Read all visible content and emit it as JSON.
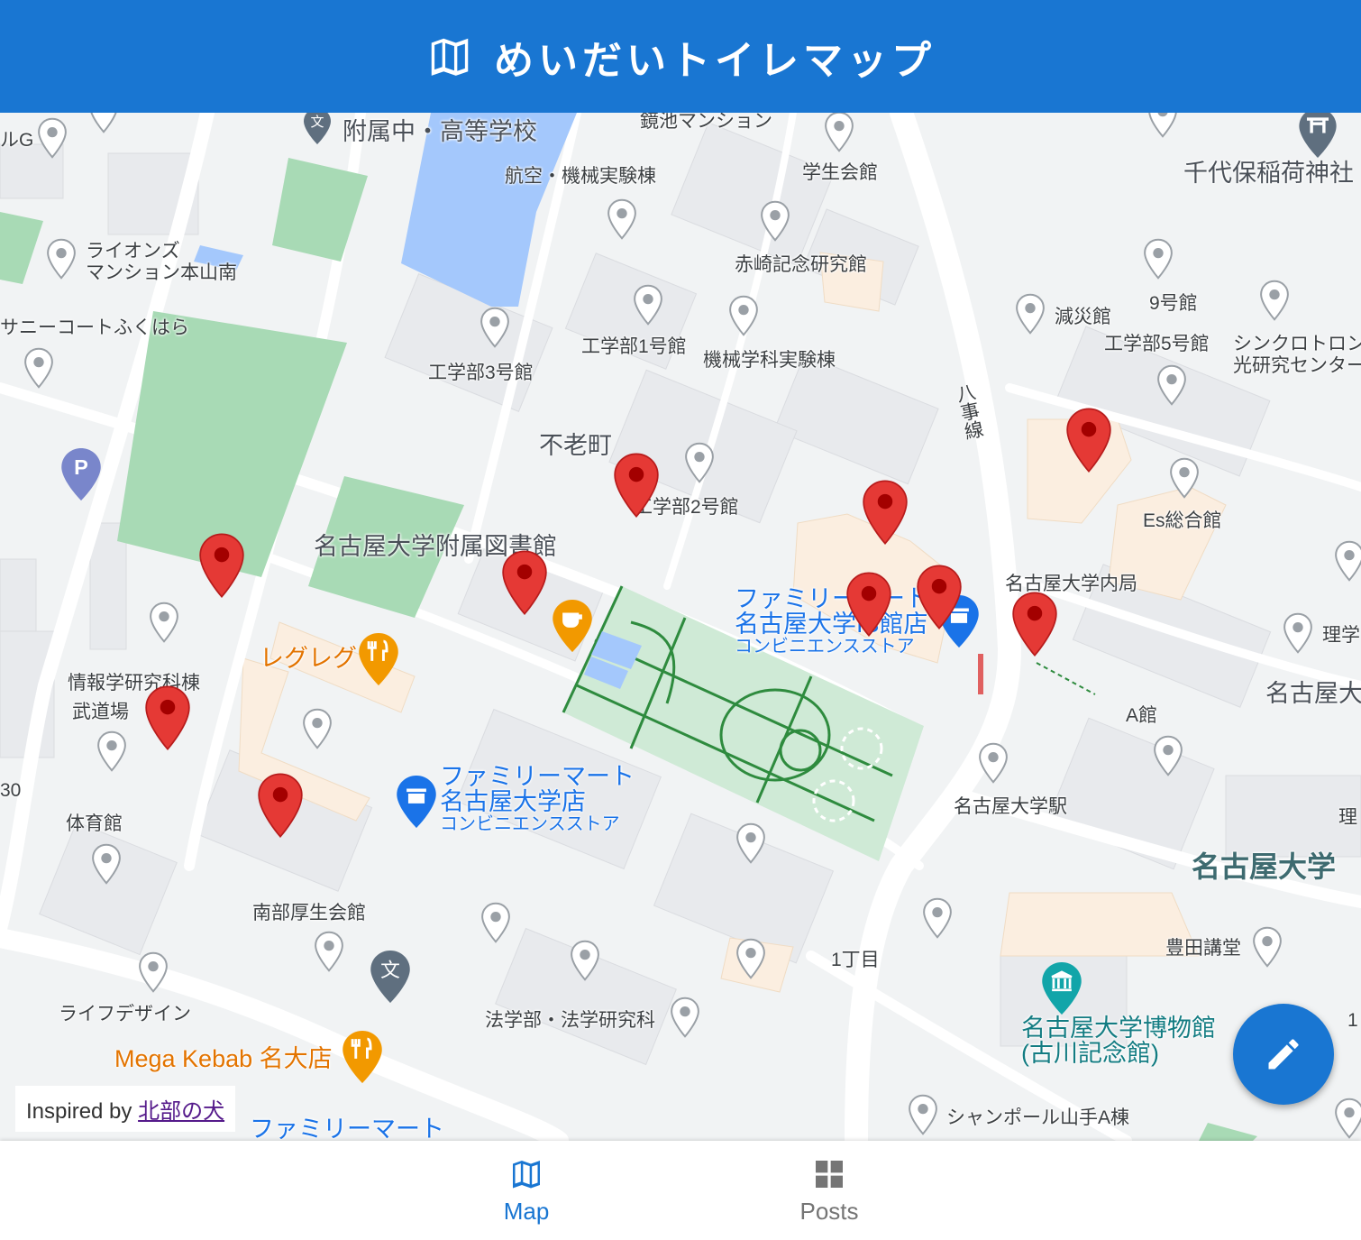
{
  "app": {
    "title": "めいだいトイレマップ"
  },
  "map": {
    "labels": {
      "fuzoku": "附属中・高等学校",
      "kagami": "鏡池マンション",
      "gakusei": "学生会館",
      "chiyoho": "千代保稲荷神社",
      "lG": "ルG",
      "koku": "航空・機械実験棟",
      "lions": "ライオンズ\nマンション本山南",
      "akasaki": "赤崎記念研究館",
      "kyu": "9号館",
      "gensai": "減災館",
      "sunny": "サニーコートふくはら",
      "kou1": "工学部1号館",
      "kikai": "機械学科実験棟",
      "kou5": "工学部5号館",
      "synch": "シンクロトロン\n光研究センター",
      "kou3": "工学部3号館",
      "hachiji": "八事線",
      "furou": "不老町",
      "kou2": "工学部2号館",
      "es": "Es総合館",
      "library": "名古屋大学附属図書館",
      "uchikyoku": "名古屋大学内局",
      "rigaku": "理学",
      "reguregu": "レグレグ",
      "joho": "情報学研究科棟",
      "budo": "武道場",
      "abuilding": "A館",
      "nagoya_daigaku_cut": "名古屋大",
      "num30": "30",
      "station": "名古屋大学駅",
      "rika2": "理",
      "taiiku": "体育館",
      "univ": "名古屋大学",
      "nanbu": "南部厚生会館",
      "toyoda": "豊田講堂",
      "chome": "1丁目",
      "lifedesign": "ライフデザイン",
      "hougaku": "法学部・法学研究科",
      "museum": "名古屋大学博物館\n(古川記念館)",
      "megakebab": "Mega Kebab 名大店",
      "shanpoel": "シャンポール山手A棟",
      "one": "1"
    },
    "fm1": {
      "name": "ファミリーマート\n名古屋大学店",
      "type": "コンビニエンスストア"
    },
    "fm2": {
      "name": "ファミリーマート\n名古屋大学IB館店",
      "type": "コンビニエンスストア"
    },
    "fm3": {
      "name": "ファミリーマート"
    }
  },
  "footer": {
    "inspired_prefix": "Inspired by ",
    "inspired_link": "北部の犬"
  },
  "nav": {
    "map_label": "Map",
    "posts_label": "Posts"
  },
  "colors": {
    "primary": "#1976d2",
    "pin_red": "#e53935",
    "park_green": "#a8dab5",
    "water_blue": "#a4c8fc"
  }
}
